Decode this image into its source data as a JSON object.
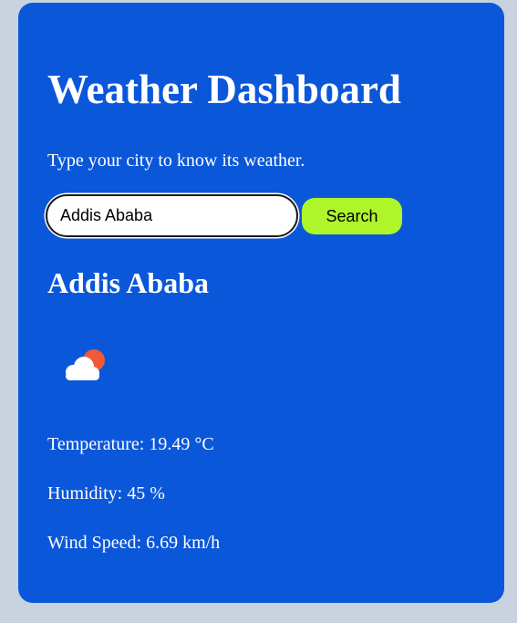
{
  "app": {
    "title": "Weather Dashboard",
    "subtitle": "Type your city to know its weather."
  },
  "search": {
    "value": "Addis Ababa",
    "button_label": "Search"
  },
  "result": {
    "city": "Addis Ababa",
    "icon": "partly-cloudy-icon",
    "temperature": "Temperature: 19.49 °C",
    "humidity": "Humidity: 45 %",
    "wind_speed": "Wind Speed: 6.69 km/h"
  },
  "colors": {
    "page_background": "#c9d3e0",
    "card_background": "#0b57d9",
    "button_background": "#aef52a",
    "text": "#ffffff",
    "sun": "#f05a36",
    "cloud": "#ffffff"
  }
}
